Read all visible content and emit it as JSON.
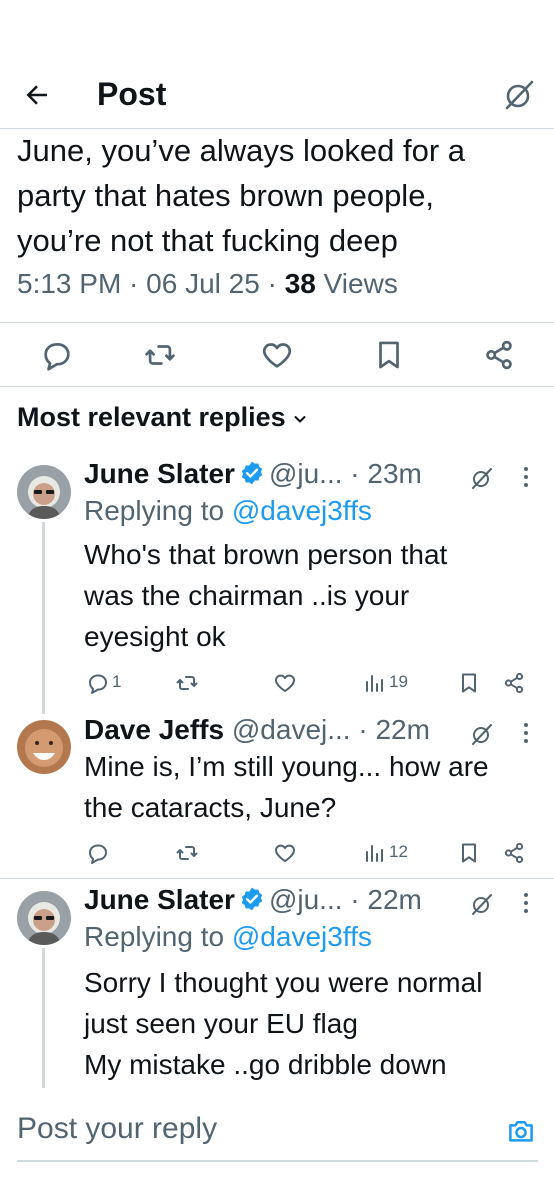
{
  "header": {
    "title": "Post"
  },
  "post": {
    "text_lines": [
      "June, you’ve always looked for a",
      "party that hates brown people,",
      "you’re not that fucking deep"
    ],
    "time": "5:13 PM",
    "sep1": " · ",
    "date": "06 Jul 25",
    "sep2": " · ",
    "views_count": "38",
    "views_label": " Views"
  },
  "replies_section": {
    "title": "Most relevant replies"
  },
  "replies": [
    {
      "name": "June Slater",
      "handle": "@ju...",
      "time": "· 23m",
      "replying_prefix": "Replying to ",
      "replying_to": "@davej3ffs",
      "body_lines": [
        "Who's that brown person that",
        "was the chairman ..is your",
        "eyesight ok"
      ],
      "reply_count": "1",
      "view_count": "19"
    },
    {
      "name": "Dave Jeffs",
      "handle": "@davej...",
      "time": "· 22m",
      "body_lines": [
        "Mine is, I’m still young... how are",
        "the cataracts, June?"
      ],
      "view_count": "12"
    },
    {
      "name": "June Slater",
      "handle": "@ju...",
      "time": "· 22m",
      "replying_prefix": "Replying to ",
      "replying_to": "@davej3ffs",
      "body_lines": [
        "Sorry I thought you were normal",
        "just seen your EU flag",
        "My mistake ..go dribble down"
      ]
    }
  ],
  "composer": {
    "placeholder": "Post your reply"
  },
  "icons": {
    "back": "arrow-left-icon",
    "grok": "grok-icon",
    "reply": "reply-icon",
    "repost": "repost-icon",
    "like": "heart-icon",
    "bookmark": "bookmark-icon",
    "share": "share-icon",
    "views": "views-icon",
    "camera": "camera-icon",
    "verified": "verified-badge-icon",
    "more": "more-icon"
  },
  "colors": {
    "accent": "#1d9bf0",
    "text": "#0f1419",
    "muted": "#536471",
    "border": "#cfd9de"
  }
}
